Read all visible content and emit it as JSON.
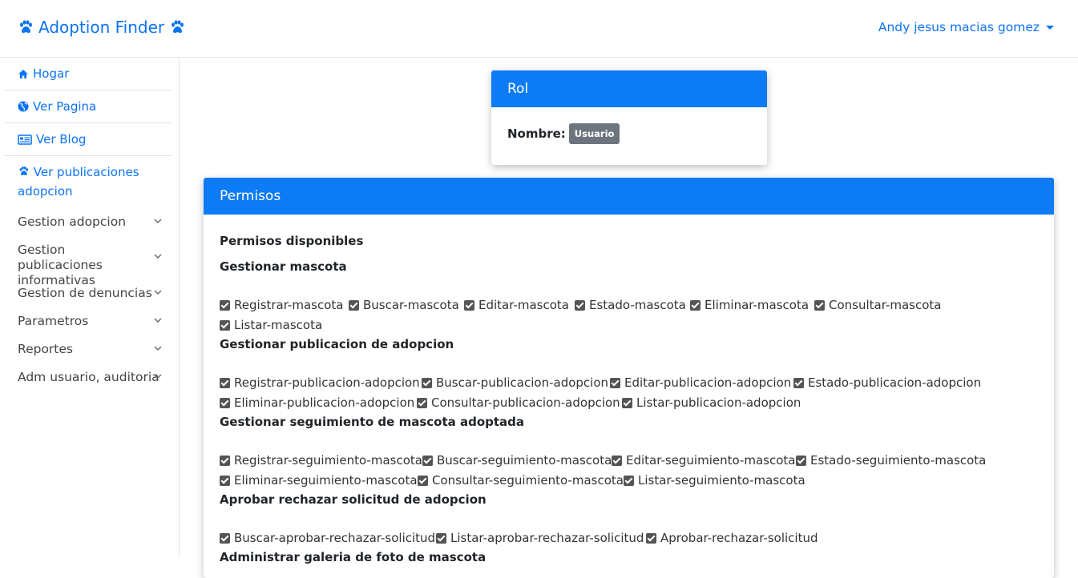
{
  "brand": {
    "title": "Adoption Finder",
    "color": "#0d74f3"
  },
  "user": {
    "name": "Andy jesus macias gomez"
  },
  "sidebar": {
    "links": [
      {
        "label": "Hogar",
        "icon": "home-icon"
      },
      {
        "label": "Ver Pagina",
        "icon": "globe-icon"
      },
      {
        "label": "Ver Blog",
        "icon": "newspaper-icon"
      },
      {
        "label": "Ver publicaciones adopcion",
        "icon": "paw-icon"
      }
    ],
    "menus": [
      {
        "label": "Gestion adopcion"
      },
      {
        "label": "Gestion publicaciones informativas"
      },
      {
        "label": "Gestion de denuncias"
      },
      {
        "label": "Parametros"
      },
      {
        "label": "Reportes"
      },
      {
        "label": "Adm usuario, auditoria"
      }
    ]
  },
  "rol_card": {
    "title": "Rol",
    "name_label": "Nombre:",
    "name_value": "Usuario"
  },
  "permisos_card": {
    "title": "Permisos",
    "subtitle": "Permisos disponibles",
    "sections": [
      {
        "title": "Gestionar mascota",
        "items": [
          "Registrar-mascota",
          "Buscar-mascota",
          "Editar-mascota",
          "Estado-mascota",
          "Eliminar-mascota",
          "Consultar-mascota",
          "Listar-mascota"
        ]
      },
      {
        "title": "Gestionar publicacion de adopcion",
        "items": [
          "Registrar-publicacion-adopcion",
          "Buscar-publicacion-adopcion",
          "Editar-publicacion-adopcion",
          "Estado-publicacion-adopcion",
          "Eliminar-publicacion-adopcion",
          "Consultar-publicacion-adopcion",
          "Listar-publicacion-adopcion"
        ]
      },
      {
        "title": "Gestionar seguimiento de mascota adoptada",
        "items": [
          "Registrar-seguimiento-mascota",
          "Buscar-seguimiento-mascota",
          "Editar-seguimiento-mascota",
          "Estado-seguimiento-mascota",
          "Eliminar-seguimiento-mascota",
          "Consultar-seguimiento-mascota",
          "Listar-seguimiento-mascota"
        ]
      },
      {
        "title": "Aprobar rechazar solicitud de adopcion",
        "items": [
          "Buscar-aprobar-rechazar-solicitud",
          "Listar-aprobar-rechazar-solicitud",
          "Aprobar-rechazar-solicitud"
        ]
      },
      {
        "title": "Administrar galeria de foto de mascota",
        "items": []
      }
    ]
  }
}
